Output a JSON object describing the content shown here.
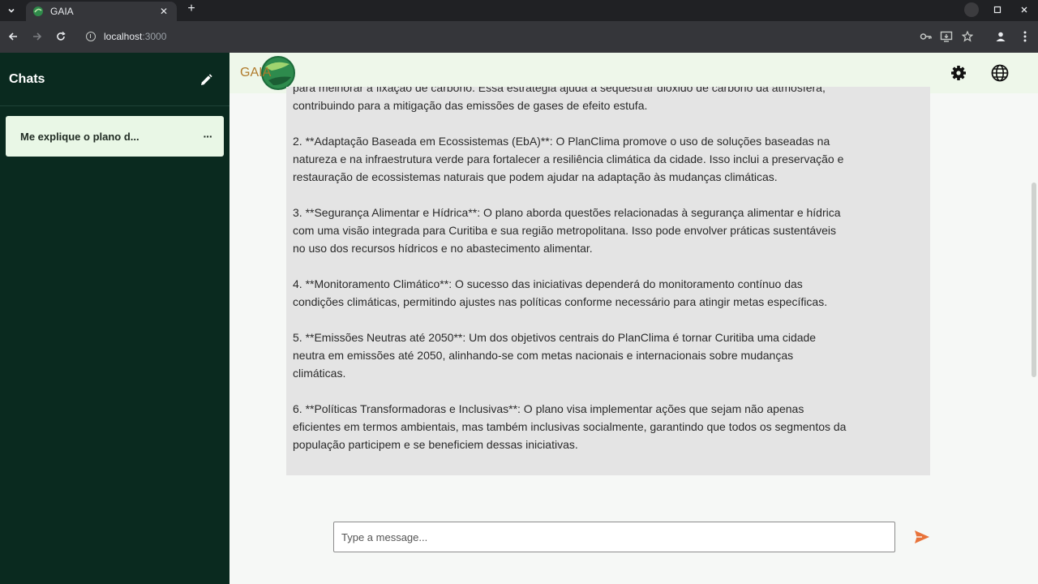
{
  "browser": {
    "tab_title": "GAIA",
    "url_host": "localhost",
    "url_port": ":3000",
    "icons": {
      "tab_search": "chevron-down-icon",
      "tab_close": "close-icon",
      "new_tab": "plus-icon",
      "back": "arrow-left-icon",
      "forward": "arrow-right-icon",
      "reload": "reload-icon",
      "site_info": "info-icon",
      "passwords": "key-icon",
      "install": "install-icon",
      "bookmark": "star-icon",
      "profile": "person-icon",
      "menu": "kebab-icon"
    }
  },
  "sidebar": {
    "title": "Chats",
    "new_chat_icon": "pencil-icon",
    "chats": [
      {
        "label": "Me explique o plano d...",
        "more": "···"
      }
    ]
  },
  "header": {
    "logo_text": "GAIA",
    "settings_icon": "gear-icon",
    "language_icon": "globe-icon"
  },
  "message": {
    "lines": [
      "para melhorar a fixação de carbono. Essa estratégia ajuda a sequestrar dióxido de carbono da atmosfera,",
      "contribuindo para a mitigação das emissões de gases de efeito estufa.",
      "",
      "2. **Adaptação Baseada em Ecossistemas (EbA)**: O PlanClima promove o uso de soluções baseadas na",
      "natureza e na infraestrutura verde para fortalecer a resiliência climática da cidade. Isso inclui a preservação e",
      "restauração de ecossistemas naturais que podem ajudar na adaptação às mudanças climáticas.",
      "",
      "3. **Segurança Alimentar e Hídrica**: O plano aborda questões relacionadas à segurança alimentar e hídrica",
      "com uma visão integrada para Curitiba e sua região metropolitana. Isso pode envolver práticas sustentáveis",
      "no uso dos recursos hídricos e no abastecimento alimentar.",
      "",
      "4. **Monitoramento Climático**: O sucesso das iniciativas dependerá do monitoramento contínuo das",
      "condições climáticas, permitindo ajustes nas políticas conforme necessário para atingir metas específicas.",
      "",
      "5. **Emissões Neutras até 2050**: Um dos objetivos centrais do PlanClima é tornar Curitiba uma cidade",
      "neutra em emissões até 2050, alinhando-se com metas nacionais e internacionais sobre mudanças",
      "climáticas.",
      "",
      "6. **Políticas Transformadoras e Inclusivas**: O plano visa implementar ações que sejam não apenas",
      "eficientes em termos ambientais, mas também inclusivas socialmente, garantindo que todos os segmentos da",
      "população participem e se beneficiem dessas iniciativas."
    ]
  },
  "composer": {
    "placeholder": "Type a message...",
    "value": "",
    "send_icon": "send-icon"
  },
  "colors": {
    "sidebar_bg": "#0a2a1f",
    "header_bg": "#eef7ea",
    "chat_item_bg": "#e9f7e6",
    "message_bg": "#e4e4e4",
    "send_accent": "#e8733a"
  }
}
